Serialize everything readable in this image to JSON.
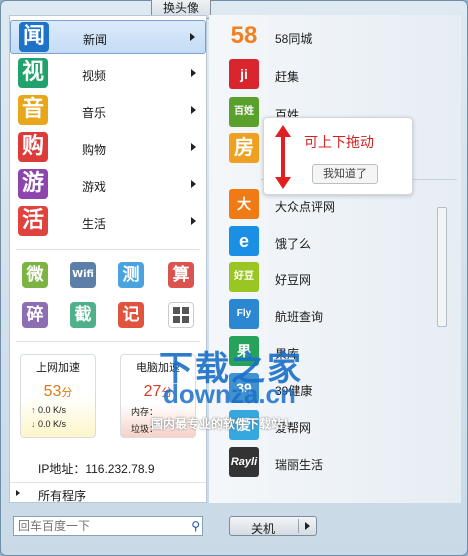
{
  "top_button": "换头像",
  "categories": [
    {
      "label": "新闻",
      "glyph": "闻",
      "color": "#1e73c9"
    },
    {
      "label": "视频",
      "glyph": "视",
      "color": "#21a16b"
    },
    {
      "label": "音乐",
      "glyph": "音",
      "color": "#e8a71a"
    },
    {
      "label": "购物",
      "glyph": "购",
      "color": "#dc3b39"
    },
    {
      "label": "游戏",
      "glyph": "游",
      "color": "#8e44ad"
    },
    {
      "label": "生活",
      "glyph": "活",
      "color": "#e0433d"
    }
  ],
  "tools": [
    {
      "glyph": "微",
      "color": "#7cb342"
    },
    {
      "glyph": "Wifi",
      "color": "#5b7fa6"
    },
    {
      "glyph": "测",
      "color": "#4aa3df"
    },
    {
      "glyph": "算",
      "color": "#d9534f"
    },
    {
      "glyph": "碎",
      "color": "#8c6fb3"
    },
    {
      "glyph": "截",
      "color": "#4fb08c"
    },
    {
      "glyph": "记",
      "color": "#e0533d"
    },
    {
      "glyph": "grid-icon",
      "color": "#ffffff"
    }
  ],
  "net": {
    "title": "上网加速",
    "score": "53",
    "unit": "分",
    "up": "0.0 K/s",
    "down": "0.0 K/s"
  },
  "pc": {
    "title": "电脑加速",
    "score": "27",
    "unit": "分",
    "mem_label": "内存：",
    "trash_label": "垃圾："
  },
  "ip": "IP地址：116.232.78.9",
  "all_programs": "所有程序",
  "sites_top": [
    {
      "label": "58同城",
      "glyph": "58",
      "color": "#ffffff",
      "text_color": "#f08020"
    },
    {
      "label": "赶集",
      "glyph": "ji",
      "color": "#d9262e",
      "text_color": "#ffffff"
    },
    {
      "label": "百姓",
      "glyph": "百姓",
      "color": "#5aa02c",
      "text_color": "#ffffff"
    },
    {
      "label": "房",
      "glyph": "房",
      "color": "#f0a020",
      "text_color": "#ffffff"
    }
  ],
  "sites_bottom": [
    {
      "label": "大众点评网",
      "glyph": "大",
      "color": "#f07a13"
    },
    {
      "label": "饿了么",
      "glyph": "e",
      "color": "#1a8fe3"
    },
    {
      "label": "好豆网",
      "glyph": "好豆",
      "color": "#9ac624"
    },
    {
      "label": "航班查询",
      "glyph": "Fly",
      "color": "#2b87d1"
    },
    {
      "label": "果库",
      "glyph": "果",
      "color": "#26a35a"
    },
    {
      "label": "39健康",
      "glyph": "39",
      "color": "#3f91cf"
    },
    {
      "label": "爱帮网",
      "glyph": "爱",
      "color": "#36a8e0"
    },
    {
      "label": "瑞丽生活",
      "glyph": "Rayli",
      "color": "#333333"
    }
  ],
  "tip": {
    "text": "可上下拖动",
    "button": "我知道了"
  },
  "search": {
    "placeholder": "回车百度一下"
  },
  "shutdown": "关机",
  "watermark": {
    "line1": "下载之家",
    "line2": "downza.cn",
    "line3": "国内最专业的软件下载站！"
  }
}
